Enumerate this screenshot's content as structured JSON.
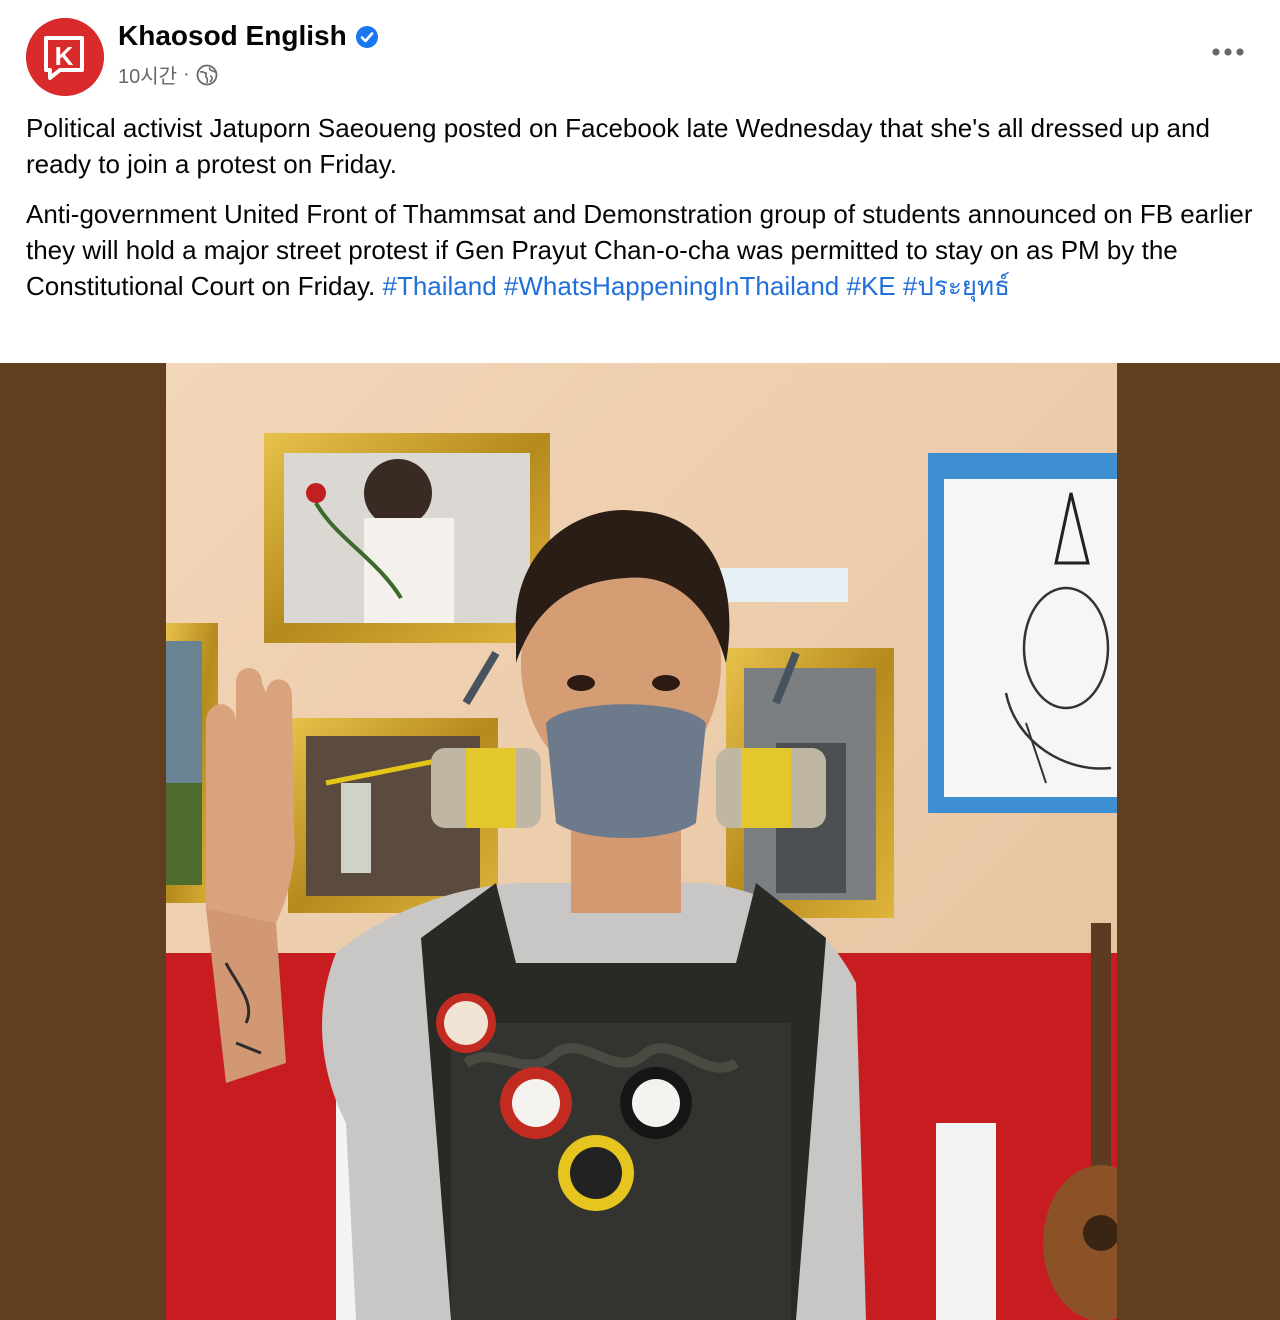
{
  "page": {
    "name": "Khaosod English",
    "timestamp": "10시간",
    "separator": "·",
    "avatar_letter": "K"
  },
  "post": {
    "paragraph1": "Political activist Jatuporn Saeoueng posted on Facebook late Wednesday that she's all dressed up and ready to join a protest on Friday.",
    "paragraph2_text": "Anti-government United Front of Thammsat and Demonstration group of students announced on FB earlier they will hold a major street protest if Gen Prayut Chan-o-cha was permitted to stay on as PM by the Constitutional Court on Friday.",
    "hashtags": [
      "#Thailand",
      "#WhatsHappeningInThailand",
      "#KE",
      "#ประยุทธ์"
    ]
  },
  "icons": {
    "verified": "verified-badge-icon",
    "audience": "globe-icon",
    "more": "more-options-icon"
  },
  "colors": {
    "brand_red": "#d92b2b",
    "link_blue": "#216fdb",
    "meta_gray": "#65676b",
    "verified_blue": "#1877f2",
    "photo_background": "#603e1f"
  }
}
